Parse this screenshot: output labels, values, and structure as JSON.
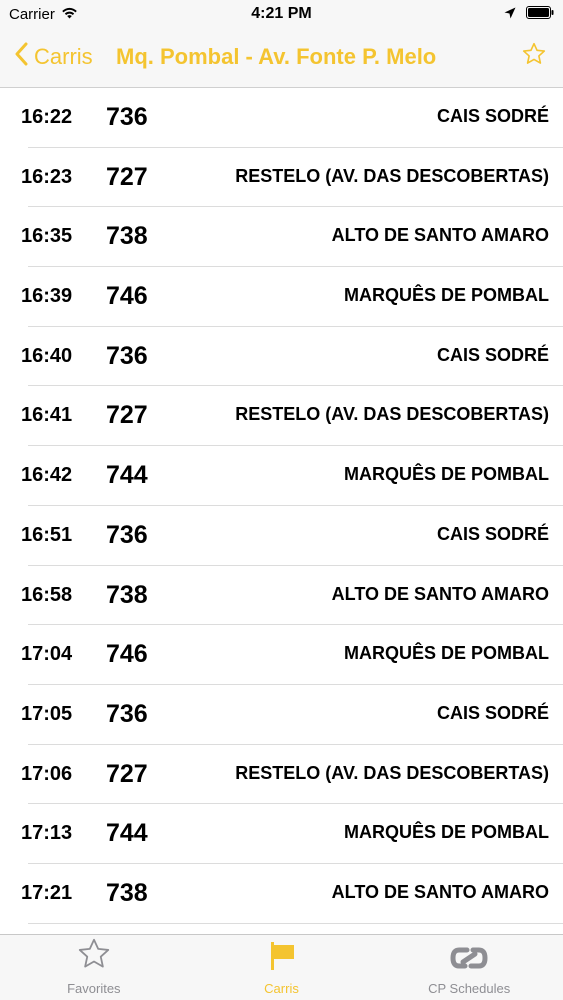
{
  "status_bar": {
    "carrier": "Carrier",
    "time": "4:21 PM"
  },
  "nav": {
    "back_label": "Carris",
    "title": "Mq. Pombal - Av. Fonte P. Melo"
  },
  "departures": [
    {
      "time": "16:22",
      "route": "736",
      "destination": "CAIS SODRÉ"
    },
    {
      "time": "16:23",
      "route": "727",
      "destination": "RESTELO (AV. DAS DESCOBERTAS)"
    },
    {
      "time": "16:35",
      "route": "738",
      "destination": "ALTO DE SANTO AMARO"
    },
    {
      "time": "16:39",
      "route": "746",
      "destination": "MARQUÊS DE POMBAL"
    },
    {
      "time": "16:40",
      "route": "736",
      "destination": "CAIS SODRÉ"
    },
    {
      "time": "16:41",
      "route": "727",
      "destination": "RESTELO (AV. DAS DESCOBERTAS)"
    },
    {
      "time": "16:42",
      "route": "744",
      "destination": "MARQUÊS DE POMBAL"
    },
    {
      "time": "16:51",
      "route": "736",
      "destination": "CAIS SODRÉ"
    },
    {
      "time": "16:58",
      "route": "738",
      "destination": "ALTO DE SANTO AMARO"
    },
    {
      "time": "17:04",
      "route": "746",
      "destination": "MARQUÊS DE POMBAL"
    },
    {
      "time": "17:05",
      "route": "736",
      "destination": "CAIS SODRÉ"
    },
    {
      "time": "17:06",
      "route": "727",
      "destination": "RESTELO (AV. DAS DESCOBERTAS)"
    },
    {
      "time": "17:13",
      "route": "744",
      "destination": "MARQUÊS DE POMBAL"
    },
    {
      "time": "17:21",
      "route": "738",
      "destination": "ALTO DE SANTO AMARO"
    }
  ],
  "tabs": [
    {
      "label": "Favorites",
      "icon": "star-icon"
    },
    {
      "label": "Carris",
      "icon": "flag-icon"
    },
    {
      "label": "CP Schedules",
      "icon": "cp-logo-icon"
    }
  ],
  "colors": {
    "accent": "#f4c430",
    "inactive": "#8e8e93"
  }
}
